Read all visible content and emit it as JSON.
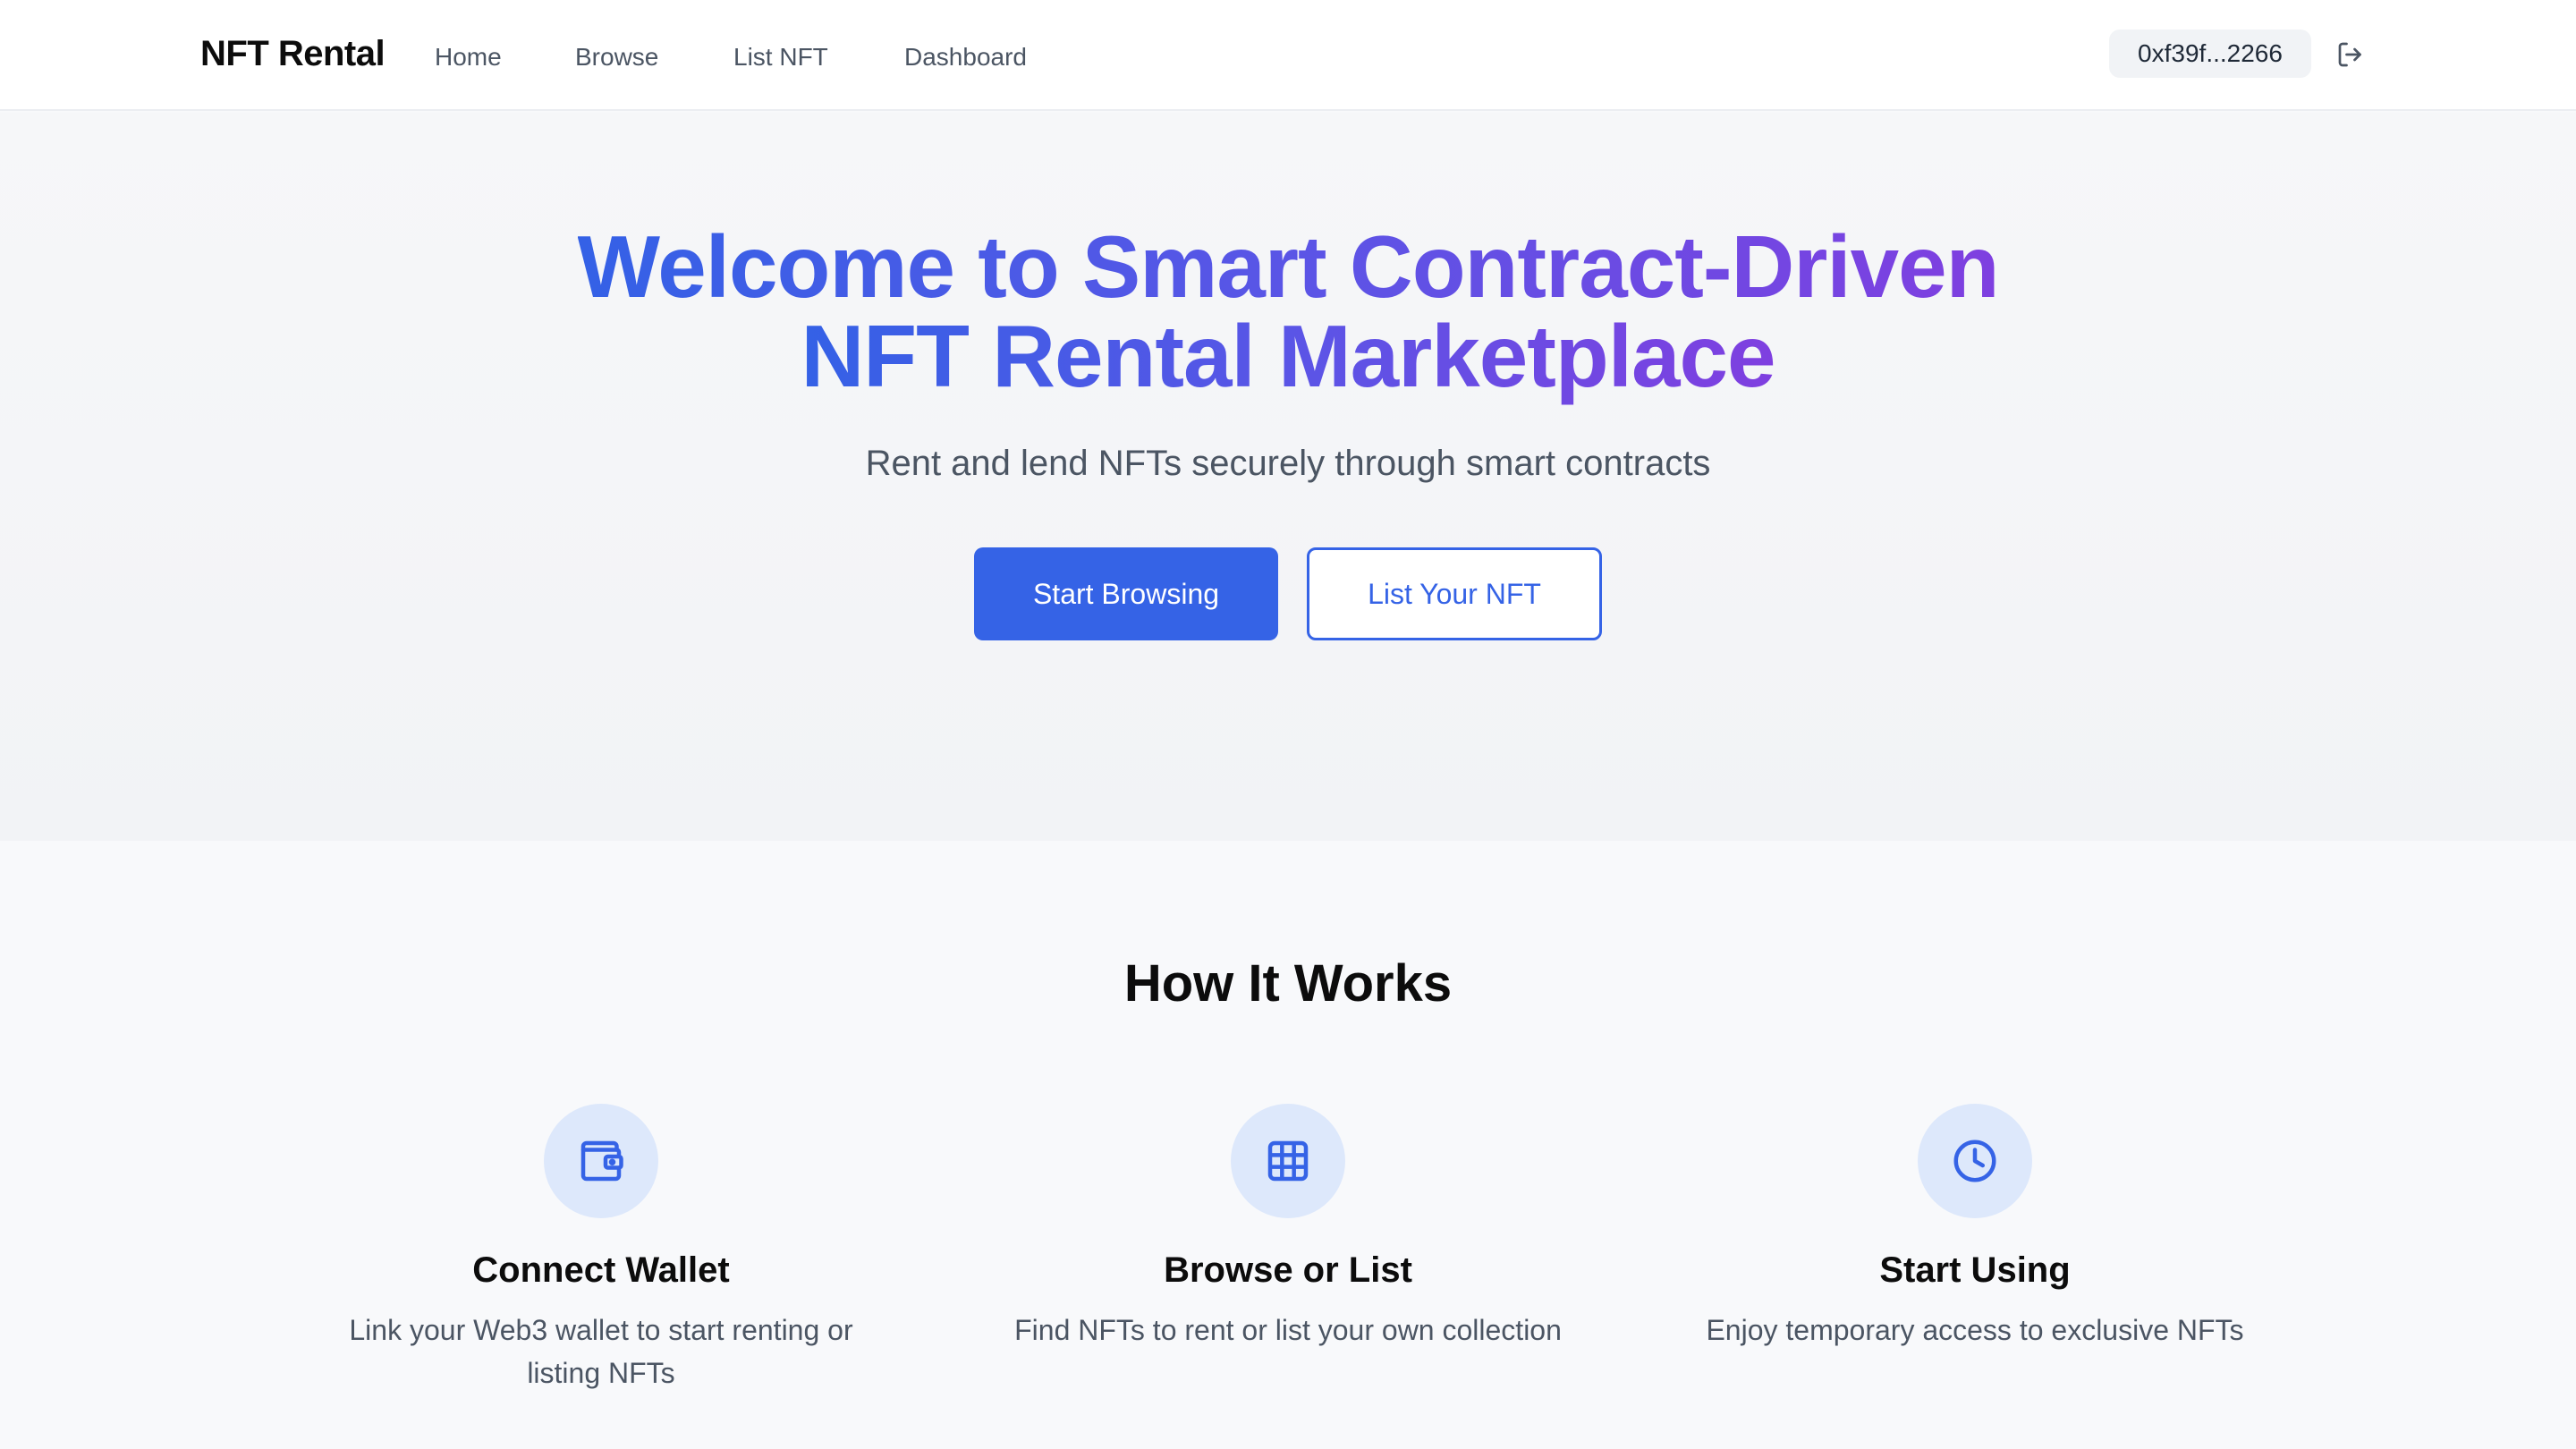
{
  "nav": {
    "brand": "NFT Rental",
    "links": [
      "Home",
      "Browse",
      "List NFT",
      "Dashboard"
    ],
    "wallet_address": "0xf39f...2266",
    "logout_icon": "logout-icon"
  },
  "hero": {
    "title_line1": "Welcome to Smart Contract-Driven",
    "title_line2": "NFT Rental Marketplace",
    "subtitle": "Rent and lend NFTs securely through smart contracts",
    "primary_button": "Start Browsing",
    "secondary_button": "List Your NFT"
  },
  "how_it_works": {
    "title": "How It Works",
    "steps": [
      {
        "icon": "wallet-icon",
        "title": "Connect Wallet",
        "description": "Link your Web3 wallet to start renting or listing NFTs"
      },
      {
        "icon": "grid-icon",
        "title": "Browse or List",
        "description": "Find NFTs to rent or list your own collection"
      },
      {
        "icon": "clock-icon",
        "title": "Start Using",
        "description": "Enjoy temporary access to exclusive NFTs"
      }
    ]
  },
  "colors": {
    "accent": "#3563e6",
    "gradient_end": "#7f3fe0",
    "icon_circle": "#dde8fb"
  }
}
